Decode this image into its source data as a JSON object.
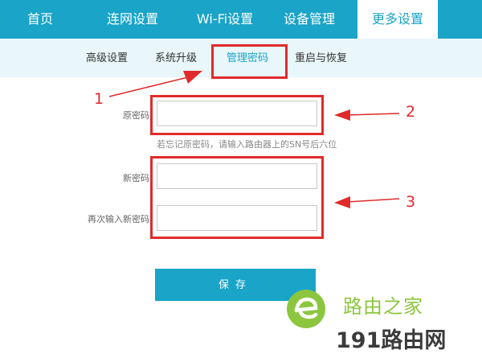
{
  "topnav": {
    "items": [
      {
        "label": "首页"
      },
      {
        "label": "连网设置"
      },
      {
        "label": "Wi-Fi设置"
      },
      {
        "label": "设备管理"
      },
      {
        "label": "更多设置"
      }
    ],
    "active_index": 4
  },
  "subnav": {
    "items": [
      {
        "label": "高级设置"
      },
      {
        "label": "系统升级"
      },
      {
        "label": "管理密码"
      },
      {
        "label": "重启与恢复"
      }
    ],
    "active_index": 2
  },
  "form": {
    "old_password_label": "原密码",
    "old_password_value": "",
    "old_password_hint": "若忘记原密码，请输入路由器上的SN号后六位",
    "new_password_label": "新密码",
    "new_password_value": "",
    "confirm_password_label": "再次输入新密码",
    "confirm_password_value": "",
    "save_label": "保存"
  },
  "annotations": {
    "callout_1": "1",
    "callout_2": "2",
    "callout_3": "3",
    "highlight_color": "#e02b2b"
  },
  "watermark": {
    "top_text": "路由之家",
    "bottom_text": "191路由网"
  },
  "colors": {
    "accent": "#1aa4c8",
    "subnav_bg": "#e9f6fa"
  }
}
